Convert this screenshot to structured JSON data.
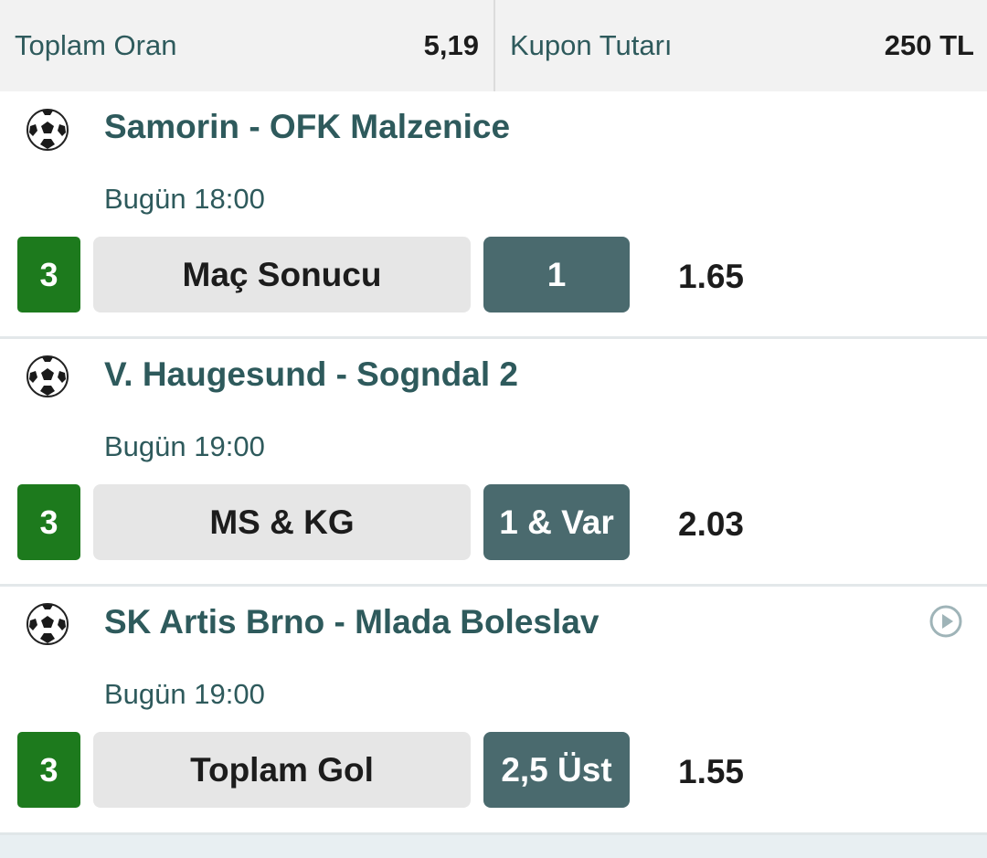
{
  "summary": {
    "total_odds_label": "Toplam Oran",
    "total_odds_value": "5,19",
    "coupon_amount_label": "Kupon Tutarı",
    "coupon_amount_value": "250 TL"
  },
  "matches": [
    {
      "title": "Samorin - OFK Malzenice",
      "time": "Bugün 18:00",
      "mbs": "3",
      "market": "Maç Sonucu",
      "pick": "1",
      "odds": "1.65",
      "icon": "soccer-ball-icon"
    },
    {
      "title": "V. Haugesund - Sogndal 2",
      "time": "Bugün 19:00",
      "mbs": "3",
      "market": "MS & KG",
      "pick": "1 & Var",
      "odds": "2.03",
      "icon": "soccer-ball-icon"
    },
    {
      "title": "SK Artis Brno - Mlada Boleslav",
      "time": "Bugün 19:00",
      "mbs": "3",
      "market": "Toplam Gol",
      "pick": "2,5 Üst",
      "odds": "1.55",
      "icon": "soccer-ball-icon",
      "extra_icon": "play-circle-icon"
    }
  ],
  "colors": {
    "accent_text": "#2e5a5c",
    "mbs_badge": "#1d7a1d",
    "pick_box": "#4a6a6e",
    "market_box": "#e6e6e6",
    "summary_bg": "#f2f2f2"
  }
}
